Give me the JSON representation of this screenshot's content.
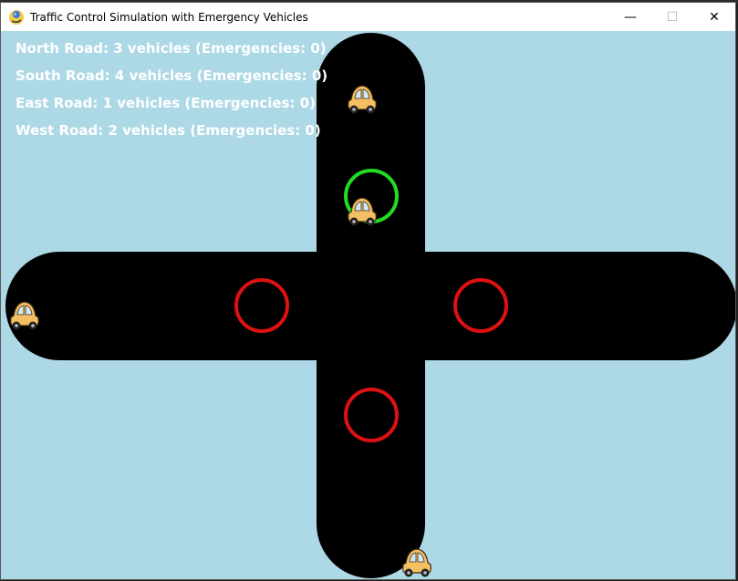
{
  "window": {
    "title": "Traffic Control Simulation with Emergency Vehicles",
    "controls": {
      "minimize": "—",
      "maximize": "☐",
      "close": "✕"
    }
  },
  "stats": {
    "north": "North Road: 3 vehicles (Emergencies: 0)",
    "south": "South Road: 4 vehicles (Emergencies: 0)",
    "east": "East Road: 1 vehicles (Emergencies: 0)",
    "west": "West Road: 2 vehicles (Emergencies: 0)"
  },
  "traffic_lights": {
    "north": "green",
    "west": "red",
    "east": "red",
    "south": "red"
  },
  "colors": {
    "background": "#add8e6",
    "road": "#000000",
    "light_green": "#22dd22",
    "light_red": "#dd1111",
    "car_body": "#f5c064",
    "text": "#ffffff"
  },
  "icons": {
    "app": "pygame-snake-icon",
    "car": "car-icon"
  }
}
